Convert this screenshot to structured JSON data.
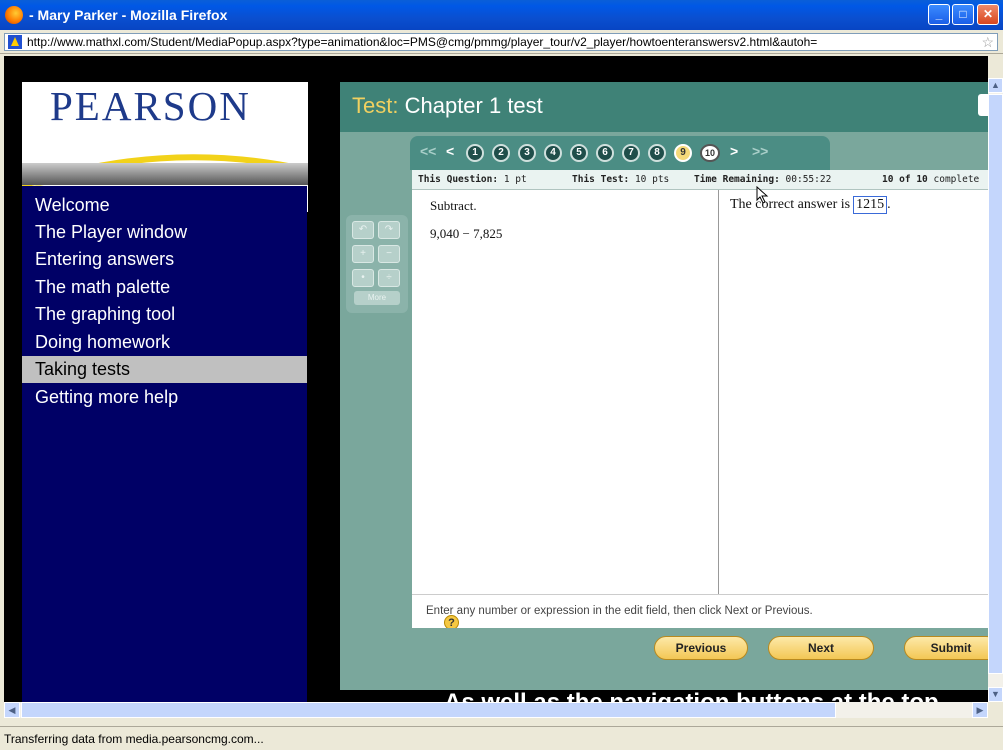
{
  "window": {
    "title": "- Mary Parker - Mozilla Firefox",
    "min_label": "_",
    "max_label": "□",
    "close_label": "✕"
  },
  "address": {
    "url": "http://www.mathxl.com/Student/MediaPopup.aspx?type=animation&loc=PMS@cmg/pmmg/player_tour/v2_player/howtoenteranswersv2.html&autoh=",
    "star": "☆"
  },
  "sidebar": {
    "logo": "PEARSON",
    "items": [
      {
        "label": "Welcome"
      },
      {
        "label": "The Player window"
      },
      {
        "label": "Entering answers"
      },
      {
        "label": "The math palette"
      },
      {
        "label": "The graphing tool"
      },
      {
        "label": "Doing homework"
      },
      {
        "label": "Taking tests"
      },
      {
        "label": "Getting more help"
      }
    ],
    "active_item": "Taking tests"
  },
  "test": {
    "title_prefix": "Test:",
    "title": "Chapter 1 test",
    "nav": {
      "first": "<<",
      "prev": "<",
      "next": ">",
      "last": ">>",
      "questions": [
        "1",
        "2",
        "3",
        "4",
        "5",
        "6",
        "7",
        "8",
        "9",
        "10"
      ],
      "current": "9"
    },
    "info": {
      "question_label": "This Question:",
      "question_value": "1 pt",
      "test_label": "This Test:",
      "test_value": "10 pts",
      "time_label": "Time Remaining:",
      "time_value": "00:55:22",
      "progress_bold": "10 of 10",
      "progress_rest": "complete"
    },
    "question": {
      "instruction": "Subtract.",
      "expression": "9,040 − 7,825",
      "answer_prefix": "The correct answer is",
      "answer_value": "1215",
      "answer_suffix": "."
    },
    "hint": "Enter any number or expression in the edit field, then click Next or Previous.",
    "help_icon": "?",
    "buttons": {
      "previous": "Previous",
      "next": "Next",
      "submit": "Submit"
    },
    "palette": {
      "undo": "↶",
      "redo": "↷",
      "plus": "+",
      "minus": "−",
      "dot": "•",
      "divide": "÷",
      "more": "More"
    }
  },
  "caption": "As well as the navigation buttons at the top",
  "status": "Transferring data from media.pearsoncmg.com..."
}
